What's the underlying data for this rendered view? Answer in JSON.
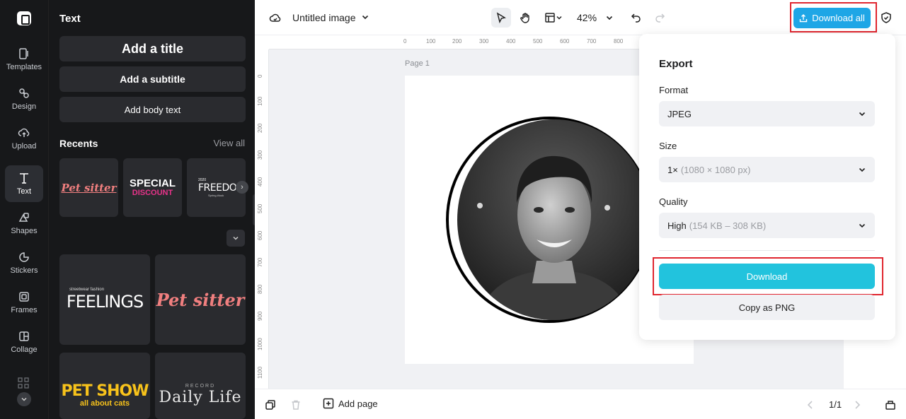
{
  "sidebar": {
    "items": [
      {
        "label": "Templates",
        "icon": "templates-icon"
      },
      {
        "label": "Design",
        "icon": "design-icon"
      },
      {
        "label": "Upload",
        "icon": "upload-icon"
      },
      {
        "label": "Text",
        "icon": "text-icon",
        "active": true
      },
      {
        "label": "Shapes",
        "icon": "shapes-icon"
      },
      {
        "label": "Stickers",
        "icon": "stickers-icon"
      },
      {
        "label": "Frames",
        "icon": "frames-icon"
      },
      {
        "label": "Collage",
        "icon": "collage-icon"
      }
    ]
  },
  "panel": {
    "title": "Text",
    "add_title": "Add a title",
    "add_subtitle": "Add a subtitle",
    "add_body": "Add body text",
    "recents_label": "Recents",
    "view_all": "View all",
    "recents": [
      {
        "text": "Pet sitter",
        "color": "#f07f7f"
      },
      {
        "text": "SPECIAL",
        "sub": "DISCOUNT",
        "color": "#ffffff",
        "sub_color": "#e8338a"
      },
      {
        "text": "FREEDOM",
        "small": "2020",
        "sub": "Spring #look",
        "color": "#ffffff"
      }
    ],
    "templates": [
      {
        "small": "streetwear fashion",
        "text": "FEELINGS",
        "sup": "(2)",
        "color": "#ffffff"
      },
      {
        "text": "Pet sitter",
        "color": "#f07f7f"
      },
      {
        "text": "PET SHOW",
        "sub": "all about cats",
        "color": "#f7c21b"
      },
      {
        "small": "RECORD",
        "text": "Daily Life",
        "color": "#e8e8e8"
      }
    ]
  },
  "topbar": {
    "title": "Untitled image",
    "zoom": "42%",
    "download_all": "Download all"
  },
  "canvas": {
    "page_label": "Page 1",
    "ruler_h": [
      "0",
      "100",
      "200",
      "300",
      "400",
      "500",
      "600",
      "700",
      "800"
    ],
    "ruler_v": [
      "0",
      "100",
      "200",
      "300",
      "400",
      "500",
      "600",
      "700",
      "800",
      "900",
      "1000",
      "1100"
    ]
  },
  "export": {
    "heading": "Export",
    "format_label": "Format",
    "format_value": "JPEG",
    "size_label": "Size",
    "size_value": "1×",
    "size_detail": "(1080 × 1080 px)",
    "quality_label": "Quality",
    "quality_value": "High",
    "quality_detail": "(154 KB – 308 KB)",
    "download": "Download",
    "copy_png": "Copy as PNG"
  },
  "bottombar": {
    "add_page": "Add page",
    "page_count": "1/1"
  },
  "colors": {
    "accent": "#1ea6e6",
    "download": "#22c3dd",
    "highlight": "#e0262f"
  }
}
